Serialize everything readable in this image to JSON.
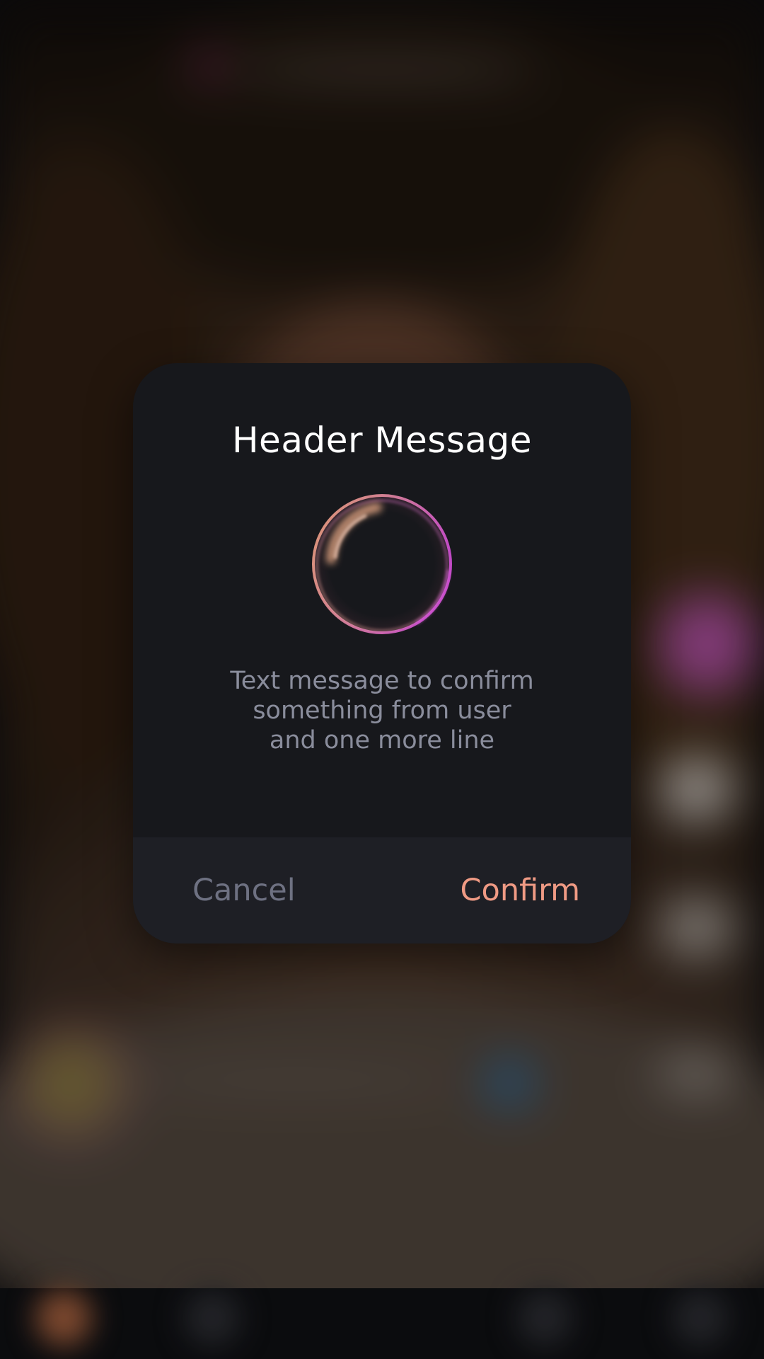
{
  "dialog": {
    "title": "Header Message",
    "body": "Text message to confirm\nsomething from user\nand one more line",
    "cancel_label": "Cancel",
    "confirm_label": "Confirm",
    "loader_icon": "gradient-ring-spinner"
  },
  "colors": {
    "dialog_background": "#17181c",
    "actions_background": "#1e1f25",
    "title": "#ffffff",
    "body_text": "#8a8d9c",
    "cancel": "#6e7182",
    "confirm": "#ef9a84",
    "loader_gradient_start": "#f2a67d",
    "loader_gradient_end": "#d34fd8"
  }
}
